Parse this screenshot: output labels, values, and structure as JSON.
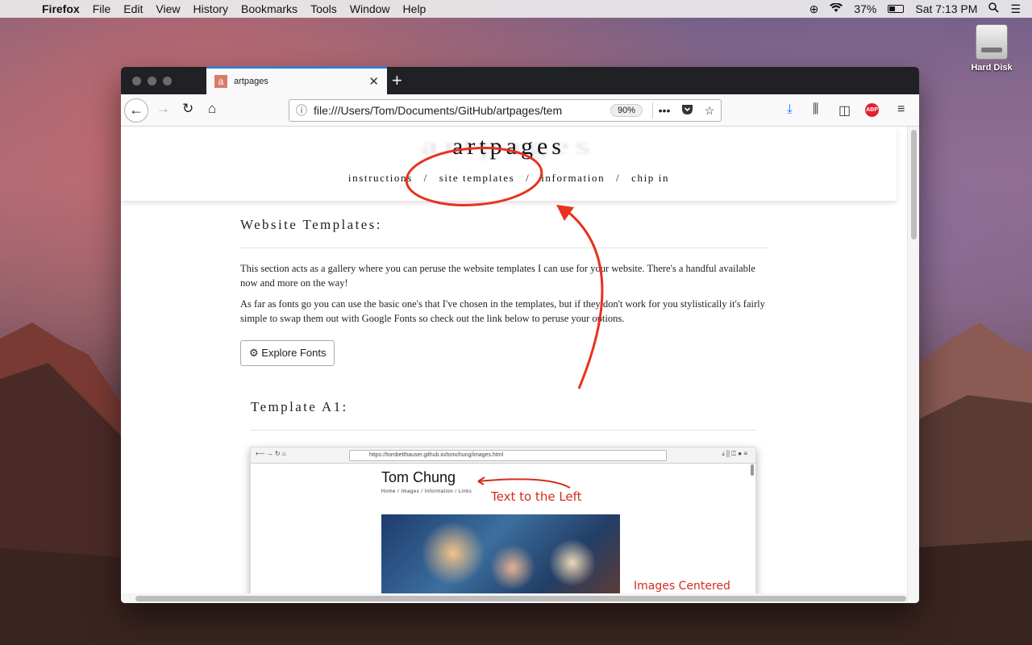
{
  "menubar": {
    "app": "Firefox",
    "items": [
      "File",
      "Edit",
      "View",
      "History",
      "Bookmarks",
      "Tools",
      "Window",
      "Help"
    ],
    "battery": "37%",
    "clock": "Sat 7:13 PM"
  },
  "desktop": {
    "icon_label": "Hard Disk"
  },
  "browser": {
    "tab_title": "artpages",
    "favicon_letter": "a",
    "url": "file:///Users/Tom/Documents/GitHub/artpages/tem",
    "zoom": "90%",
    "abp": "ABP"
  },
  "site": {
    "brand": "artpages",
    "nav": [
      "instructions",
      "site templates",
      "information",
      "chip in"
    ],
    "nav_separator": "/",
    "heading": "Website Templates:",
    "para1": "This section acts as a gallery where you can peruse the website templates I can use for your website. There's a handful available now and more on the way!",
    "para2": "As far as fonts go you can use the basic one's that I've chosen in the templates, but if they don't work for you stylistically it's fairly simple to swap them out with Google Fonts so check out the link below to peruse your options.",
    "button_icon": "⚙",
    "button": "Explore Fonts",
    "template_heading": "Template A1:"
  },
  "preview": {
    "url": "https://tombetthauser.github.io/tomchung/images.html",
    "title": "Tom Chung",
    "nav": "Home / Images / Information / Links",
    "note_left": "Text to the Left",
    "note_center": "Images Centered"
  },
  "colors": {
    "annotation": "#e8321f",
    "tab_accent": "#0a84ff",
    "abp": "#e3202d"
  }
}
